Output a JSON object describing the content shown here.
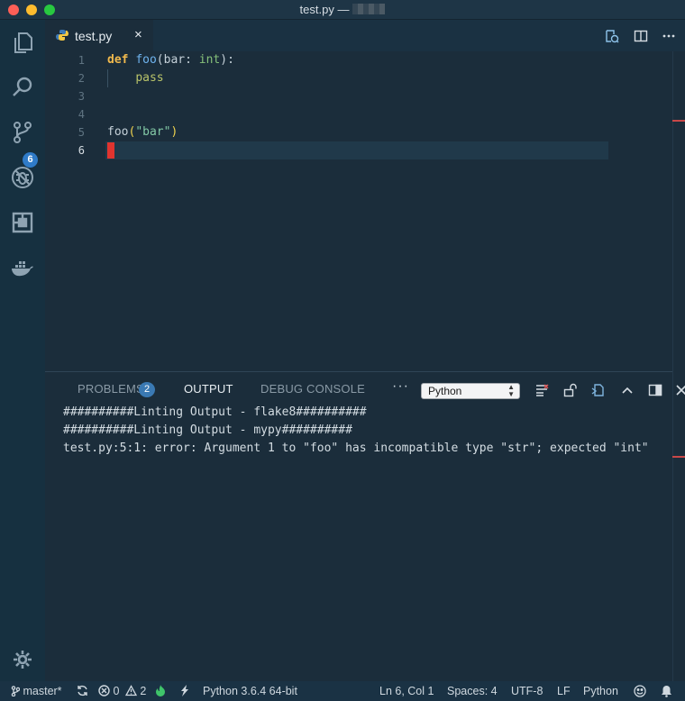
{
  "window": {
    "title": "test.py —"
  },
  "activity_bar": {
    "items": [
      {
        "name": "explorer-icon"
      },
      {
        "name": "search-icon"
      },
      {
        "name": "source-control-icon",
        "badge": "6"
      },
      {
        "name": "debug-icon"
      },
      {
        "name": "extensions-icon"
      },
      {
        "name": "docker-icon"
      }
    ],
    "settings": "gear-icon"
  },
  "tabs": [
    {
      "label": "test.py",
      "icon": "python-icon",
      "close": "×"
    }
  ],
  "editor": {
    "lines": [
      {
        "num": "1"
      },
      {
        "num": "2"
      },
      {
        "num": "3"
      },
      {
        "num": "4"
      },
      {
        "num": "5"
      },
      {
        "num": "6"
      }
    ],
    "tokens": {
      "def": "def",
      "foo": "foo",
      "lparen": "(",
      "param": "bar",
      "colon": ": ",
      "int": "int",
      "rparen_colon": "):",
      "pass": "pass",
      "call_foo": "foo",
      "call_lparen": "(",
      "call_arg": "\"bar\"",
      "call_rparen": ")"
    }
  },
  "panel": {
    "tabs": {
      "problems": "PROBLEMS",
      "problems_count": "2",
      "output": "OUTPUT",
      "debug_console": "DEBUG CONSOLE"
    },
    "more": "···",
    "channel_select": "Python",
    "output_lines": [
      "##########Linting Output - flake8##########",
      "##########Linting Output - mypy##########",
      "test.py:5:1: error: Argument 1 to \"foo\" has incompatible type \"str\"; expected \"int\""
    ]
  },
  "status_bar": {
    "branch": "master*",
    "errors": "0",
    "warnings": "2",
    "interpreter": "Python 3.6.4 64-bit",
    "position": "Ln 6, Col 1",
    "spaces": "Spaces: 4",
    "encoding": "UTF-8",
    "eol": "LF",
    "language": "Python"
  },
  "colors": {
    "background": "#1b2d3b",
    "activity_bar": "#163040",
    "accent_badge": "#2f7bc8",
    "cursor": "#e0342f",
    "keyword": "#f0b94d",
    "function": "#6fb4ef"
  }
}
